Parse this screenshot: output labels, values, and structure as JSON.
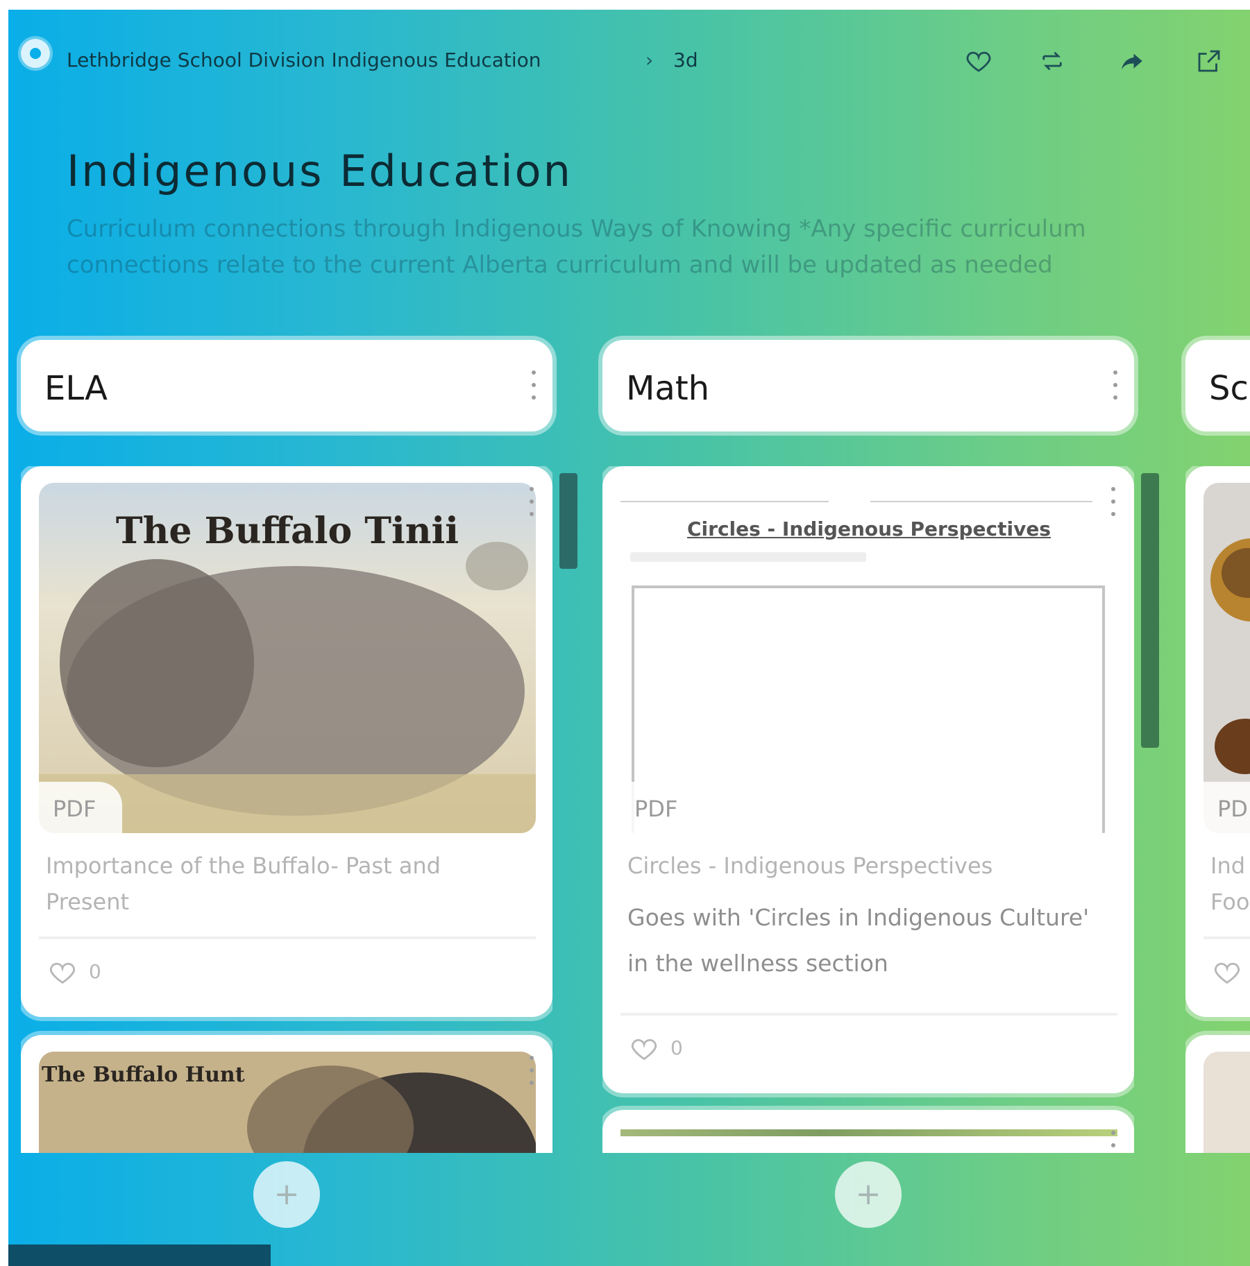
{
  "breadcrumb": {
    "org": "Lethbridge School Division Indigenous Education",
    "separator": "›",
    "current": "3d"
  },
  "toolbar": {
    "icons": [
      "heart-icon",
      "remix-icon",
      "share-icon",
      "open-external-icon"
    ]
  },
  "header": {
    "title": "Indigenous Education",
    "subtitle": "Curriculum connections through Indigenous Ways of Knowing *Any specific curriculum connections relate to the current Alberta curriculum and will be updated as needed"
  },
  "columns": [
    {
      "title": "ELA",
      "cards": [
        {
          "badge": "PDF",
          "thumb_title": "The Buffalo Tinii",
          "title": "Importance of the Buffalo- Past and Present",
          "likes": "0"
        },
        {
          "thumb_title": "The Buffalo Hunt"
        }
      ]
    },
    {
      "title": "Math",
      "cards": [
        {
          "badge": "PDF",
          "thumb_title": "Circles - Indigenous Perspectives",
          "title": "Circles - Indigenous Perspectives",
          "description": "Goes with 'Circles in Indigenous Culture' in the wellness section",
          "likes": "0"
        }
      ]
    },
    {
      "title": "Sc",
      "cards": [
        {
          "badge": "PD",
          "title": "Ind Foo"
        }
      ]
    }
  ],
  "add_button_label": "+",
  "colors": {
    "gradient_start": "#0aaee8",
    "gradient_end": "#83d26f",
    "ela_scrollbar": "#2a6b68",
    "math_scrollbar": "#3e7a4f"
  }
}
